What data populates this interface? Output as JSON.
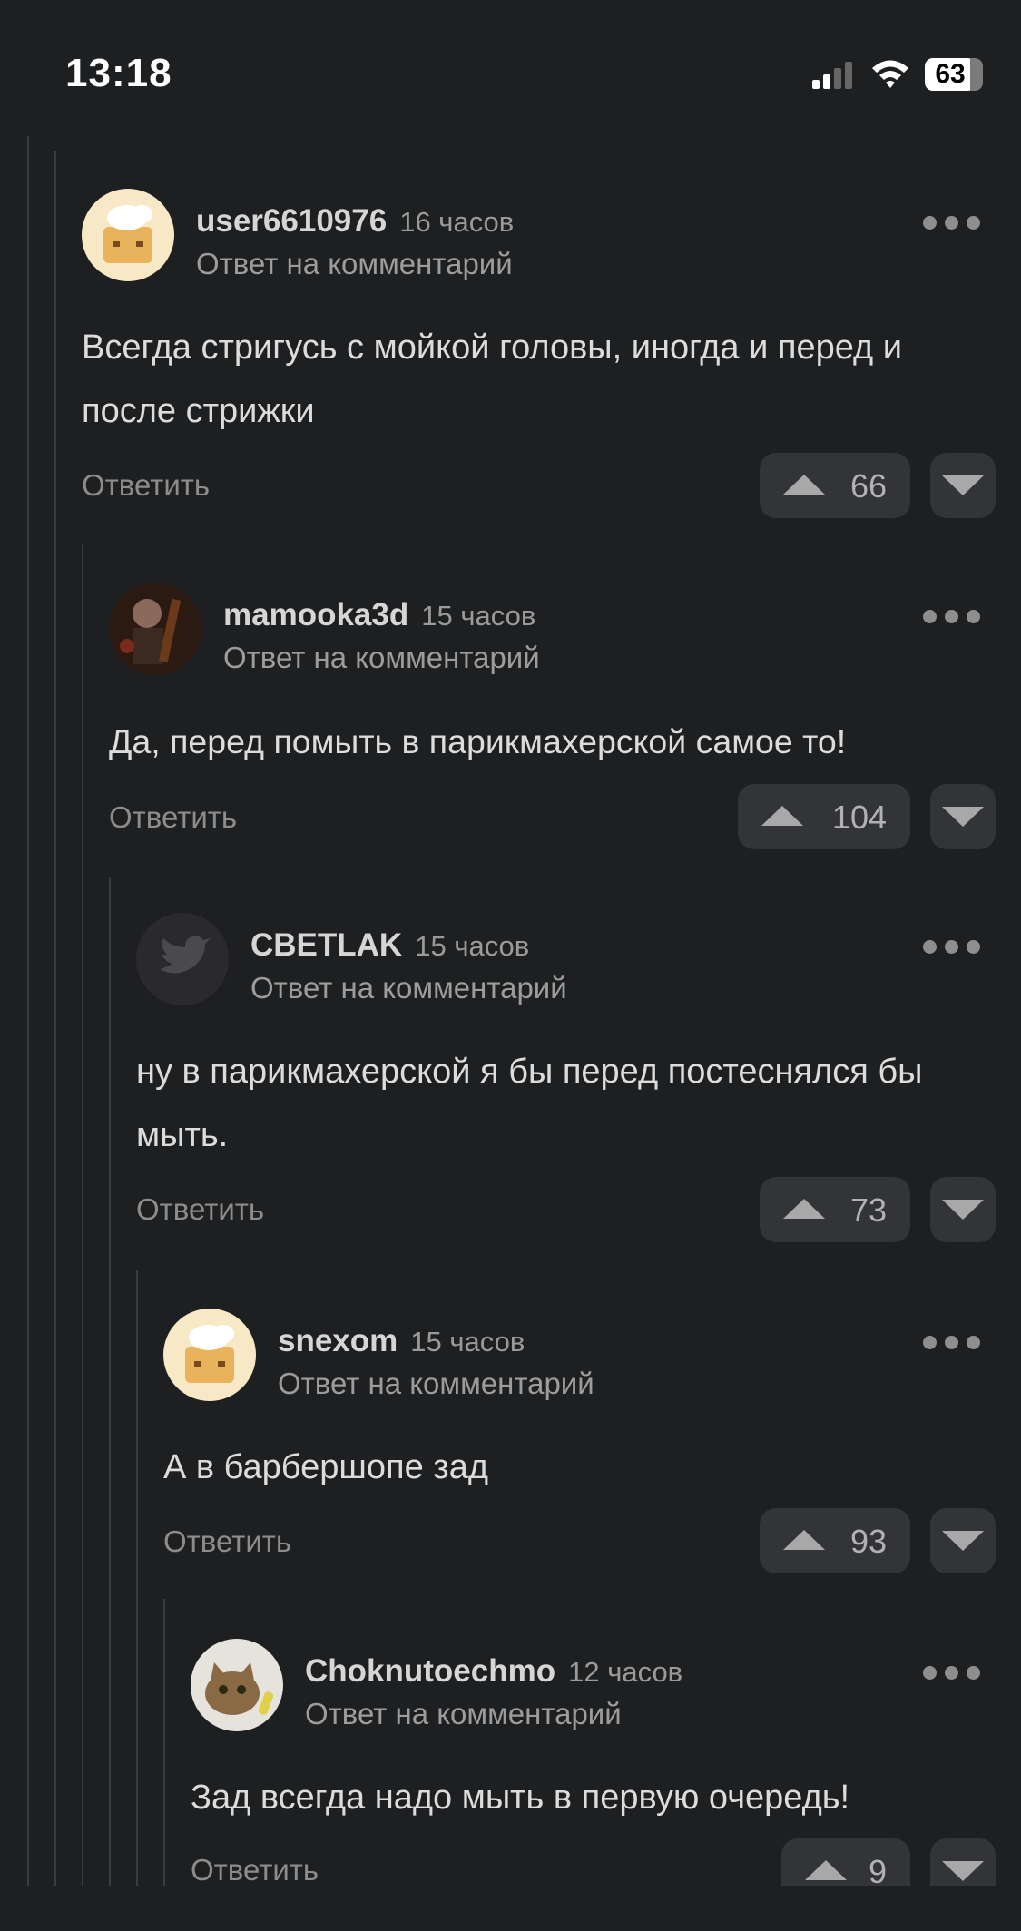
{
  "status_bar": {
    "time": "13:18",
    "battery": "63",
    "icons": [
      "signal-icon",
      "wifi-icon",
      "battery-icon"
    ]
  },
  "labels": {
    "reply": "Ответить",
    "reply_subtitle": "Ответ на комментарий"
  },
  "comments": [
    {
      "username": "user6610976",
      "time": "16 часов",
      "text": "Всегда стригусь с мойкой головы, иногда и перед и после стрижки",
      "votes": "66",
      "avatar": "chef-hat-avatar"
    },
    {
      "username": "mamooka3d",
      "time": "15 часов",
      "text": "Да, перед помыть в парикмахерской самое то!",
      "votes": "104",
      "avatar": "musician-photo-avatar"
    },
    {
      "username": "CBETLAK",
      "time": "15 часов",
      "text": "ну в парикмахерской я бы перед постеснялся бы мыть.",
      "votes": "73",
      "avatar": "bird-logo-avatar"
    },
    {
      "username": "snexom",
      "time": "15 часов",
      "text": "А в барбершопе зад",
      "votes": "93",
      "avatar": "chef-hat-avatar"
    },
    {
      "username": "Choknutoechmo",
      "time": "12 часов",
      "text": "Зад всегда надо мыть в первую очередь!",
      "votes": "9",
      "avatar": "cat-photo-avatar"
    }
  ],
  "colors": {
    "background": "#1e1f21",
    "button": "#323438",
    "text": "#dcdcdc",
    "muted": "#9c9c9c"
  }
}
